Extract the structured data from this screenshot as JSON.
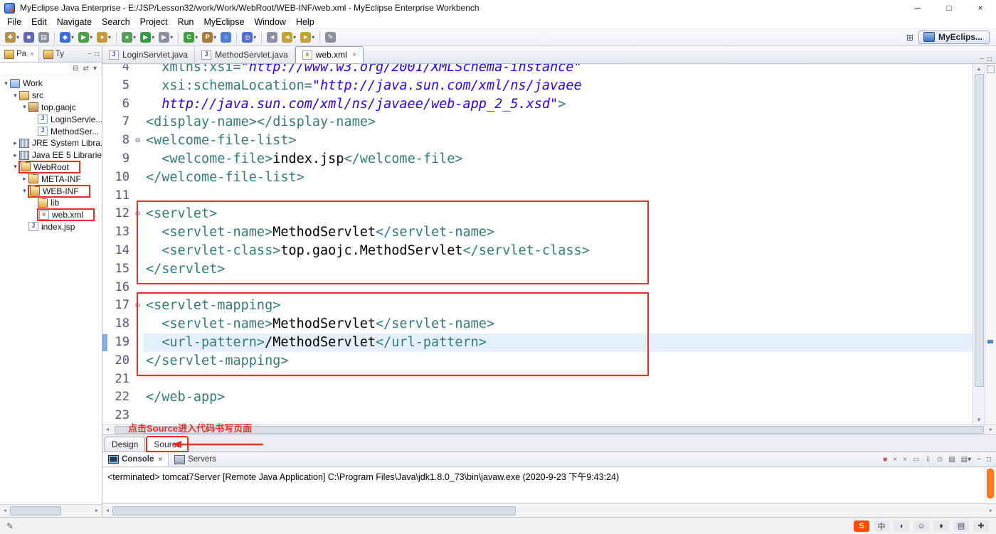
{
  "window": {
    "title": "MyEclipse Java Enterprise - E:/JSP/Lesson32/work/Work/WebRoot/WEB-INF/web.xml - MyEclipse Enterprise Workbench",
    "minimize": "─",
    "maximize": "□",
    "close": "×"
  },
  "menubar": {
    "items": [
      "File",
      "Edit",
      "Navigate",
      "Search",
      "Project",
      "Run",
      "MyEclipse",
      "Window",
      "Help"
    ]
  },
  "toolbar": {
    "buttons": [
      {
        "name": "new-wizard",
        "glyph": "✚",
        "bg": "#b79347",
        "dd": true
      },
      {
        "name": "save",
        "glyph": "■",
        "bg": "#6266b5",
        "dd": false
      },
      {
        "name": "print",
        "glyph": "▤",
        "bg": "#8b8f9e",
        "dd": false
      },
      {
        "name": "deploy",
        "glyph": "◆",
        "bg": "#3d6fd0",
        "dd": true,
        "sep": true
      },
      {
        "name": "run-server",
        "glyph": "▶",
        "bg": "#4b9e4b",
        "dd": true
      },
      {
        "name": "database-explorer",
        "glyph": "●",
        "bg": "#c29b3d",
        "dd": true
      },
      {
        "name": "debug",
        "glyph": "●",
        "bg": "#58a058",
        "dd": true,
        "sep": true
      },
      {
        "name": "run",
        "glyph": "▶",
        "bg": "#2f9e44",
        "dd": true
      },
      {
        "name": "external-tools",
        "glyph": "▶",
        "bg": "#8b8f9e",
        "dd": true
      },
      {
        "name": "new-java-class",
        "glyph": "C",
        "bg": "#3f9e3f",
        "dd": true,
        "sep": true
      },
      {
        "name": "new-java-package",
        "glyph": "P",
        "bg": "#a87c3e",
        "dd": true
      },
      {
        "name": "open-type",
        "glyph": "○",
        "bg": "#4f7fd0",
        "dd": false
      },
      {
        "name": "search",
        "glyph": "◎",
        "bg": "#4f6fd0",
        "dd": true,
        "sep": true
      },
      {
        "name": "last-edit-location",
        "glyph": "◄",
        "bg": "#8b8f9e",
        "dd": false,
        "sep": true
      },
      {
        "name": "back",
        "glyph": "◄",
        "bg": "#c2a23d",
        "dd": true
      },
      {
        "name": "forward",
        "glyph": "►",
        "bg": "#c2a23d",
        "dd": true
      },
      {
        "name": "mark-occurrences",
        "glyph": "✎",
        "bg": "#8b8f9e",
        "dd": false,
        "sep": true
      }
    ]
  },
  "perspective": {
    "open_glyph": "⊞",
    "label": "MyEclips..."
  },
  "explorer": {
    "tabs": [
      {
        "label": "Pa",
        "close": "×",
        "active": true
      },
      {
        "label": "Ty",
        "close": "",
        "active": false
      }
    ],
    "toolbar": [
      {
        "name": "collapse-all",
        "glyph": "⊟"
      },
      {
        "name": "link-with-editor",
        "glyph": "⇄"
      },
      {
        "name": "view-menu",
        "glyph": "▾"
      }
    ],
    "tree": [
      {
        "label": "Work",
        "level": 0,
        "icon": "project",
        "exp": "open"
      },
      {
        "label": "src",
        "level": 1,
        "icon": "src",
        "exp": "open"
      },
      {
        "label": "top.gaojc",
        "level": 2,
        "icon": "package",
        "exp": "open"
      },
      {
        "label": "LoginServle...",
        "level": 3,
        "icon": "java",
        "exp": "none"
      },
      {
        "label": "MethodSer...",
        "level": 3,
        "icon": "java",
        "exp": "none"
      },
      {
        "label": "JRE System Libra...",
        "level": 1,
        "icon": "library",
        "exp": "closed"
      },
      {
        "label": "Java EE 5 Librarie...",
        "level": 1,
        "icon": "library",
        "exp": "closed"
      },
      {
        "label": "WebRoot",
        "level": 1,
        "icon": "folder",
        "exp": "open",
        "boxed": true
      },
      {
        "label": "META-INF",
        "level": 2,
        "icon": "folder",
        "exp": "closed"
      },
      {
        "label": "WEB-INF",
        "level": 2,
        "icon": "folder",
        "exp": "open",
        "boxed": true
      },
      {
        "label": "lib",
        "level": 3,
        "icon": "folder",
        "exp": "none"
      },
      {
        "label": "web.xml",
        "level": 3,
        "icon": "xml",
        "exp": "none",
        "boxed": true
      },
      {
        "label": "index.jsp",
        "level": 2,
        "icon": "jsp",
        "exp": "none"
      }
    ]
  },
  "editor": {
    "tabs": [
      {
        "label": "LoginServlet.java",
        "icon": "java",
        "active": false,
        "close": ""
      },
      {
        "label": "MethodServlet.java",
        "icon": "java",
        "active": false,
        "close": ""
      },
      {
        "label": "web.xml",
        "icon": "xml",
        "active": true,
        "close": "×"
      }
    ],
    "current_line": 19,
    "fold_lines": [
      8,
      12,
      17
    ],
    "fold_glyph": "⊖",
    "boxes": [
      {
        "from": 12,
        "to": 15
      },
      {
        "from": 17,
        "to": 20
      }
    ],
    "lines": [
      {
        "n": 4,
        "seg": [
          [
            "attr",
            "  xmlns:xsi="
          ],
          [
            "val",
            "\"http://www.w3.org/2001/XMLSchema-instance\""
          ]
        ]
      },
      {
        "n": 5,
        "seg": [
          [
            "attr",
            "  xsi:schemaLocation="
          ],
          [
            "val",
            "\"http://java.sun.com/xml/ns/javaee"
          ]
        ]
      },
      {
        "n": 6,
        "seg": [
          [
            "val",
            "  http://java.sun.com/xml/ns/javaee/web-app_2_5.xsd\""
          ],
          [
            "tag",
            ">"
          ]
        ]
      },
      {
        "n": 7,
        "seg": [
          [
            "tag",
            "<display-name></display-name>"
          ]
        ]
      },
      {
        "n": 8,
        "seg": [
          [
            "tag",
            "<welcome-file-list>"
          ]
        ]
      },
      {
        "n": 9,
        "seg": [
          [
            "tag",
            "  <welcome-file>"
          ],
          [
            "txt",
            "index.jsp"
          ],
          [
            "tag",
            "</welcome-file>"
          ]
        ]
      },
      {
        "n": 10,
        "seg": [
          [
            "tag",
            "</welcome-file-list>"
          ]
        ]
      },
      {
        "n": 11,
        "seg": []
      },
      {
        "n": 12,
        "seg": [
          [
            "tag",
            "<servlet>"
          ]
        ]
      },
      {
        "n": 13,
        "seg": [
          [
            "tag",
            "  <servlet-name>"
          ],
          [
            "txt",
            "MethodServlet"
          ],
          [
            "tag",
            "</servlet-name>"
          ]
        ]
      },
      {
        "n": 14,
        "seg": [
          [
            "tag",
            "  <servlet-class>"
          ],
          [
            "txt",
            "top.gaojc.MethodServlet"
          ],
          [
            "tag",
            "</servlet-class>"
          ]
        ]
      },
      {
        "n": 15,
        "seg": [
          [
            "tag",
            "</servlet>"
          ]
        ]
      },
      {
        "n": 16,
        "seg": []
      },
      {
        "n": 17,
        "seg": [
          [
            "tag",
            "<servlet-mapping>"
          ]
        ]
      },
      {
        "n": 18,
        "seg": [
          [
            "tag",
            "  <servlet-name>"
          ],
          [
            "txt",
            "MethodServlet"
          ],
          [
            "tag",
            "</servlet-name>"
          ]
        ]
      },
      {
        "n": 19,
        "seg": [
          [
            "tag",
            "  <url-pattern>"
          ],
          [
            "txt",
            "/MethodServlet"
          ],
          [
            "tag",
            "</url-pattern>"
          ]
        ]
      },
      {
        "n": 20,
        "seg": [
          [
            "tag",
            "</servlet-mapping>"
          ]
        ]
      },
      {
        "n": 21,
        "seg": []
      },
      {
        "n": 22,
        "seg": [
          [
            "tag",
            "</web-app>"
          ]
        ]
      },
      {
        "n": 23,
        "seg": []
      }
    ],
    "mode_tabs": [
      {
        "label": "Design",
        "active": false,
        "boxed": false
      },
      {
        "label": "Source",
        "active": true,
        "boxed": true
      }
    ],
    "annotation": "点击Source进入代码书写页面"
  },
  "console": {
    "tabs": [
      {
        "label": "Console",
        "icon": "console",
        "active": true,
        "close": "×"
      },
      {
        "label": "Servers",
        "icon": "servers",
        "active": false,
        "close": ""
      }
    ],
    "toolbar": [
      {
        "name": "terminate",
        "glyph": "■",
        "color": "#b56060"
      },
      {
        "name": "remove-launch",
        "glyph": "×",
        "color": "#778"
      },
      {
        "name": "remove-all-launches",
        "glyph": "×",
        "color": "#778"
      },
      {
        "name": "clear-console",
        "glyph": "▭",
        "color": "#778"
      },
      {
        "name": "scroll-lock",
        "glyph": "⇩",
        "color": "#778"
      },
      {
        "name": "pin-console",
        "glyph": "⊙",
        "color": "#778"
      },
      {
        "name": "display-selected-console",
        "glyph": "▤",
        "color": "#556"
      },
      {
        "name": "open-console",
        "glyph": "▤▾",
        "color": "#556"
      },
      {
        "name": "minimize-panel",
        "glyph": "−",
        "color": "#445"
      },
      {
        "name": "maximize-panel",
        "glyph": "□",
        "color": "#445"
      }
    ],
    "message": "<terminated> tomcat7Server [Remote Java Application] C:\\Program Files\\Java\\jdk1.8.0_73\\bin\\javaw.exe (2020-9-23 下午9:43:24)"
  },
  "statusbar": {
    "left_icon": "✎",
    "tray": [
      {
        "name": "sogou-input",
        "glyph": "S"
      },
      {
        "name": "input-mode-chinese",
        "glyph": "中"
      },
      {
        "name": "punctuation-mode",
        "glyph": "◖"
      },
      {
        "name": "emoji-picker",
        "glyph": "☺"
      },
      {
        "name": "voice-input",
        "glyph": "♦"
      },
      {
        "name": "soft-keyboard",
        "glyph": "▤"
      },
      {
        "name": "input-toolbox",
        "glyph": "✚"
      }
    ]
  },
  "colors": {
    "tag": "#357a7a",
    "attribute_value": "#2a00ff",
    "text": "#000000",
    "annotation_red": "#e33225",
    "current_line": "#e4f1fd"
  }
}
